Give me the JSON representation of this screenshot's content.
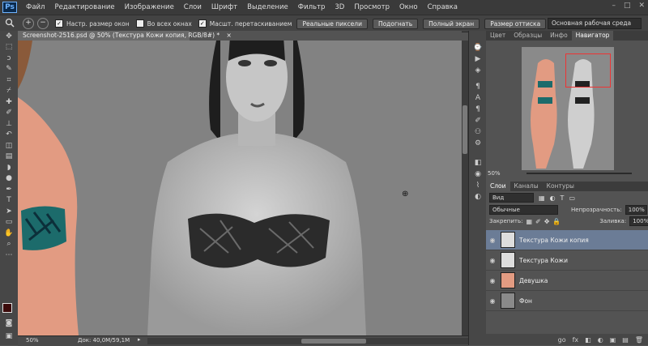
{
  "app": {
    "logo": "Ps"
  },
  "menu": [
    "Файл",
    "Редактирование",
    "Изображение",
    "Слои",
    "Шрифт",
    "Выделение",
    "Фильтр",
    "3D",
    "Просмотр",
    "Окно",
    "Справка"
  ],
  "window_controls": [
    "–",
    "□",
    "✕"
  ],
  "options": {
    "zoom_in_icon": "+",
    "zoom_out_icon": "−",
    "fit_windows": "Настр. размер окон",
    "all_windows": "Во всех окнах",
    "scrubby_zoom": "Масшт. перетаскиванием",
    "actual_pixels": "Реальные пиксели",
    "fit_screen": "Подогнать",
    "fill_screen": "Полный экран",
    "print_size": "Размер оттиска",
    "workspace": "Основная рабочая среда"
  },
  "document": {
    "tab_title": "Screenshot-2516.psd @ 50% (Текстура Кожи копия, RGB/8#) *",
    "tab_close": "×",
    "zoom": "50%",
    "doc_info": "Док: 40,0M/59,1M"
  },
  "panels": {
    "top_tabs": [
      "Цвет",
      "Образцы",
      "Инфо",
      "Навигатор"
    ],
    "active_top_tab": "Навигатор",
    "nav_zoom": "50%",
    "layer_tabs": [
      "Слои",
      "Каналы",
      "Контуры"
    ],
    "filter_label": "Вид",
    "blend_mode": "Обычные",
    "opacity_label": "Непрозрачность:",
    "opacity_value": "100%",
    "lock_label": "Закрепить:",
    "fill_label": "Заливка:",
    "fill_value": "100%",
    "layers": [
      {
        "name": "Текстура Кожи копия"
      },
      {
        "name": "Текстура Кожи"
      },
      {
        "name": "Девушка"
      },
      {
        "name": "Фон"
      }
    ],
    "footer_icons": [
      "go",
      "fx",
      "◧",
      "◐",
      "▣",
      "▤",
      "🗑"
    ]
  },
  "colors": {
    "selected_layer": "#6b7c96",
    "nav_box": "#ee3333",
    "skin": "#e8a38a"
  }
}
